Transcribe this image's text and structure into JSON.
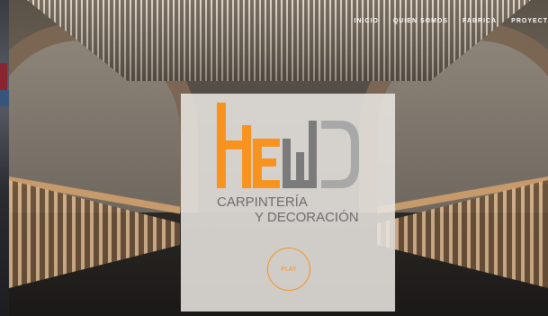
{
  "nav": {
    "items": [
      "INICIO",
      "QUIEN SOMOS",
      "FABRICA",
      "PROYECT"
    ]
  },
  "brand": {
    "logo_text": "HEWD",
    "line1": "CARPINTERÍA",
    "line2": "Y DECORACIÓN",
    "orange": "#f7931e",
    "gray": "#7b7b7b"
  },
  "hero": {
    "play_label": "PLAY"
  }
}
